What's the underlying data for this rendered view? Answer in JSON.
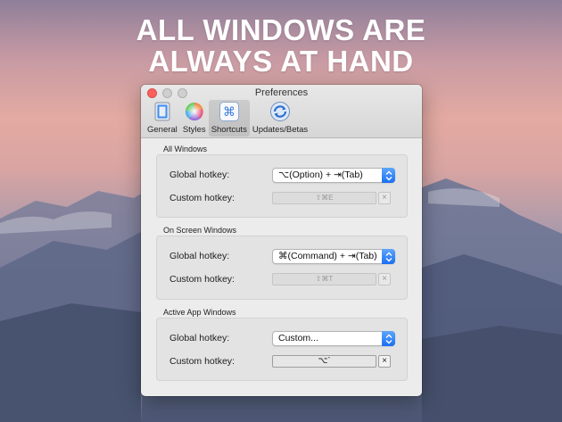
{
  "headline": {
    "line1": "ALL WINDOWS ARE",
    "line2": "ALWAYS AT HAND"
  },
  "window": {
    "title": "Preferences",
    "toolbar": [
      {
        "label": "General",
        "icon": "general-icon",
        "active": false
      },
      {
        "label": "Styles",
        "icon": "color-wheel-icon",
        "active": false
      },
      {
        "label": "Shortcuts",
        "icon": "command-key-icon",
        "active": true
      },
      {
        "label": "Updates/Betas",
        "icon": "updates-icon",
        "active": false
      }
    ]
  },
  "sections": [
    {
      "title": "All Windows",
      "global_label": "Global hotkey:",
      "global_value": "⌥(Option) + ⇥(Tab)",
      "custom_label": "Custom hotkey:",
      "custom_value": "⇧⌘E",
      "custom_enabled": false
    },
    {
      "title": "On Screen Windows",
      "global_label": "Global hotkey:",
      "global_value": "⌘(Command) + ⇥(Tab)",
      "custom_label": "Custom hotkey:",
      "custom_value": "⇧⌘T",
      "custom_enabled": false
    },
    {
      "title": "Active App Windows",
      "global_label": "Global hotkey:",
      "global_value": "Custom...",
      "custom_label": "Custom hotkey:",
      "custom_value": "⌥`",
      "custom_enabled": true
    }
  ],
  "clear_glyph": "×",
  "colors": {
    "close": "#fc605c",
    "accent": "#1a6ff3",
    "headline": "#ffffff"
  }
}
